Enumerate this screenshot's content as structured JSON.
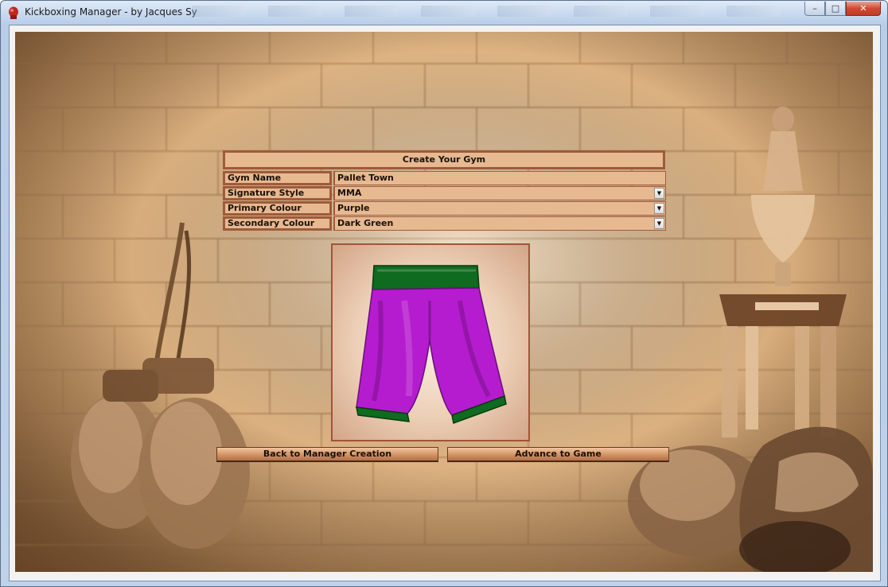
{
  "window": {
    "title": "Kickboxing Manager - by Jacques Sy",
    "minimize_glyph": "–",
    "maximize_glyph": "□",
    "close_glyph": "✕"
  },
  "form": {
    "title": "Create Your Gym",
    "rows": [
      {
        "label": "Gym Name",
        "value": "Pallet Town",
        "type": "text"
      },
      {
        "label": "Signature Style",
        "value": "MMA",
        "type": "dropdown"
      },
      {
        "label": "Primary Colour",
        "value": "Purple",
        "type": "dropdown"
      },
      {
        "label": "Secondary Colour",
        "value": "Dark Green",
        "type": "dropdown"
      }
    ],
    "dropdown_arrow": "▼"
  },
  "preview": {
    "primary_color": "#b51ccf",
    "secondary_color": "#0f6b1f"
  },
  "buttons": {
    "back": "Back to Manager Creation",
    "advance": "Advance to Game"
  },
  "icons": {
    "app": "boxing-glove-icon",
    "dropdown": "chevron-down-icon"
  }
}
